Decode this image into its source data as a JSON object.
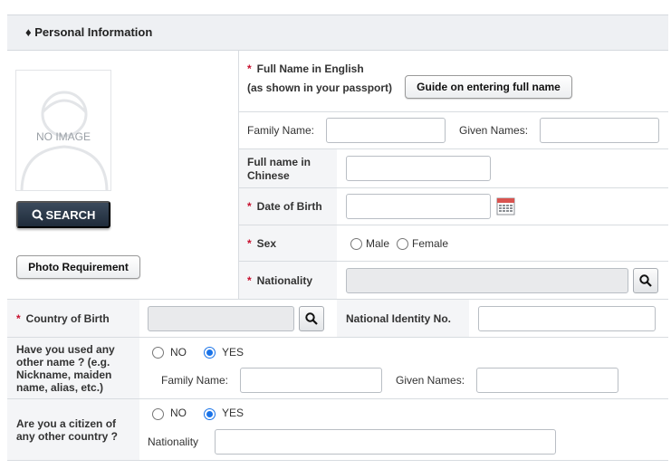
{
  "section": {
    "bullet": "♦",
    "title": "Personal Information"
  },
  "photo": {
    "placeholder_text": "NO IMAGE",
    "search_label": "SEARCH",
    "requirement_label": "Photo Requirement"
  },
  "full_name": {
    "label_line1": "Full Name in English",
    "label_line2": "(as shown in your passport)",
    "guide_button": "Guide on entering full name",
    "family_name_label": "Family Name:",
    "given_names_label": "Given Names:",
    "family_name_value": "",
    "given_names_value": ""
  },
  "chinese_name": {
    "label_line1": "Full name in",
    "label_line2": "Chinese",
    "value": ""
  },
  "dob": {
    "label": "Date of Birth",
    "value": ""
  },
  "sex": {
    "label": "Sex",
    "options": [
      "Male",
      "Female"
    ],
    "selected": ""
  },
  "nationality": {
    "label": "Nationality",
    "value": ""
  },
  "country_of_birth": {
    "label": "Country of Birth",
    "value": ""
  },
  "national_id": {
    "label": "National Identity No.",
    "value": ""
  },
  "other_name": {
    "question_lines": [
      "Have you used any",
      "other name ? (e.g.",
      "Nickname, maiden",
      "name, alias, etc.)"
    ],
    "no_label": "NO",
    "yes_label": "YES",
    "selected": "YES",
    "family_name_label": "Family Name:",
    "given_names_label": "Given Names:",
    "family_name_value": "",
    "given_names_value": ""
  },
  "other_citizen": {
    "question_lines": [
      "Are you a citizen of",
      "any other country ?"
    ],
    "no_label": "NO",
    "yes_label": "YES",
    "selected": "YES",
    "nationality_label": "Nationality",
    "nationality_value": ""
  },
  "colors": {
    "required": "#c8102e",
    "radio_checked": "#1a73e8",
    "search_button": "#2a3747"
  },
  "required_mark": "*"
}
